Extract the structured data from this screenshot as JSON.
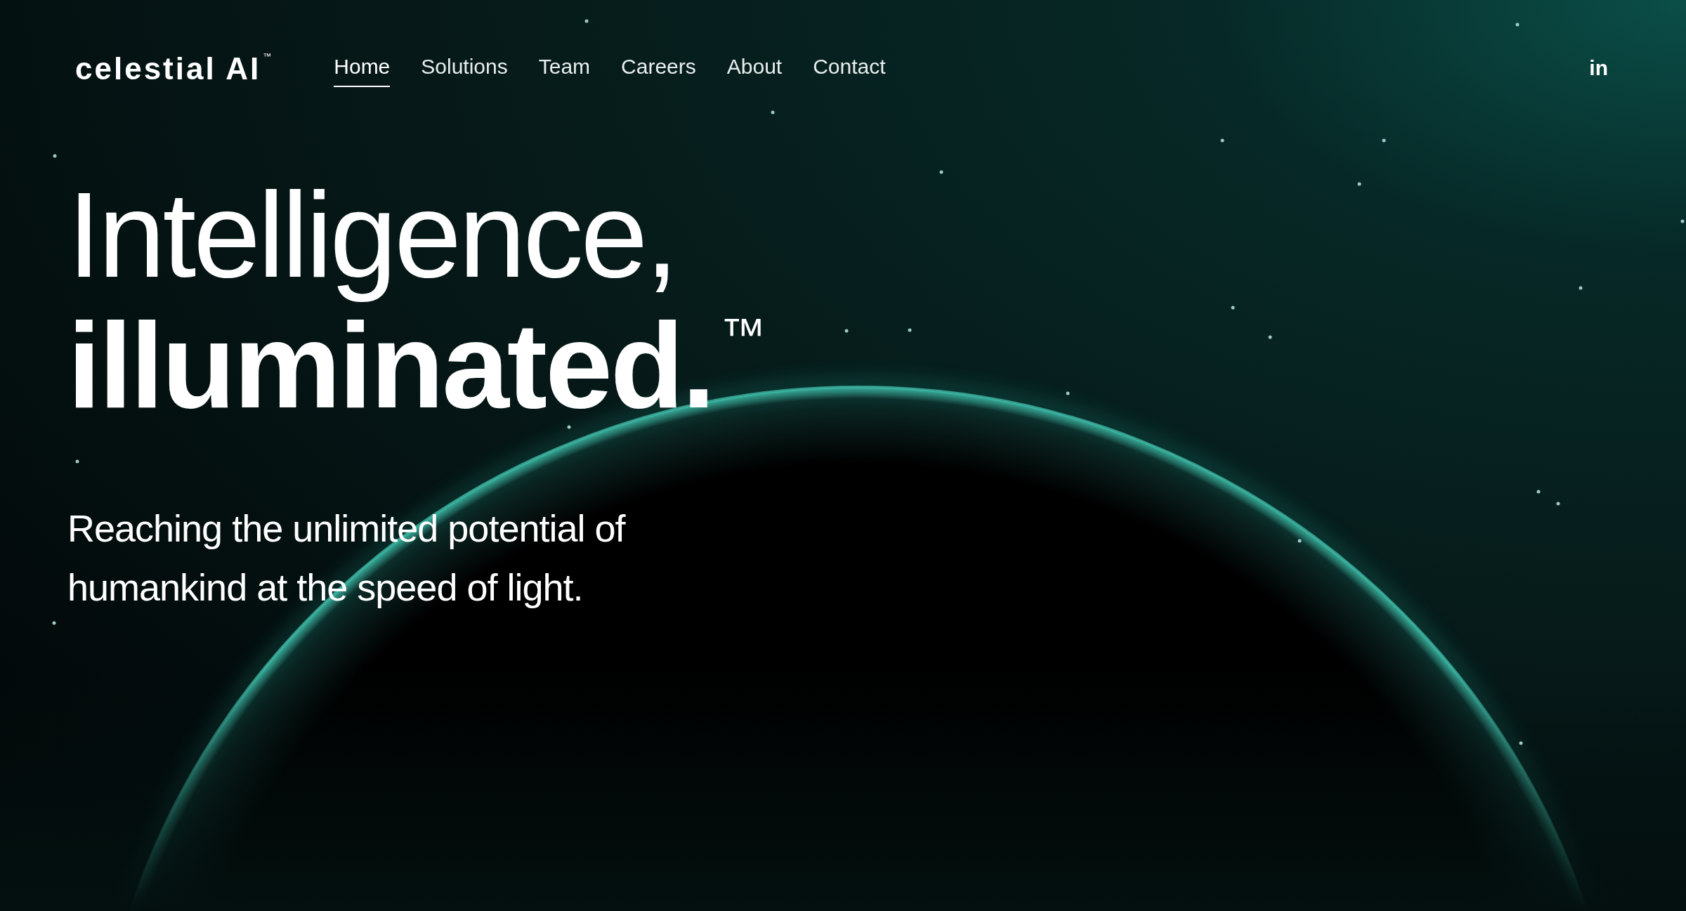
{
  "logo": {
    "text": "celestial AI",
    "mark": "™"
  },
  "nav": [
    {
      "label": "Home",
      "selected": true
    },
    {
      "label": "Solutions",
      "selected": false
    },
    {
      "label": "Team",
      "selected": false
    },
    {
      "label": "Careers",
      "selected": false
    },
    {
      "label": "About",
      "selected": false
    },
    {
      "label": "Contact",
      "selected": false
    }
  ],
  "social": {
    "label": "in"
  },
  "hero": {
    "line_1": "Intelligence,",
    "line_2": "illuminated.",
    "mark": "™",
    "subtitle": "Reaching the unlimited potential of humankind at the speed of light."
  }
}
